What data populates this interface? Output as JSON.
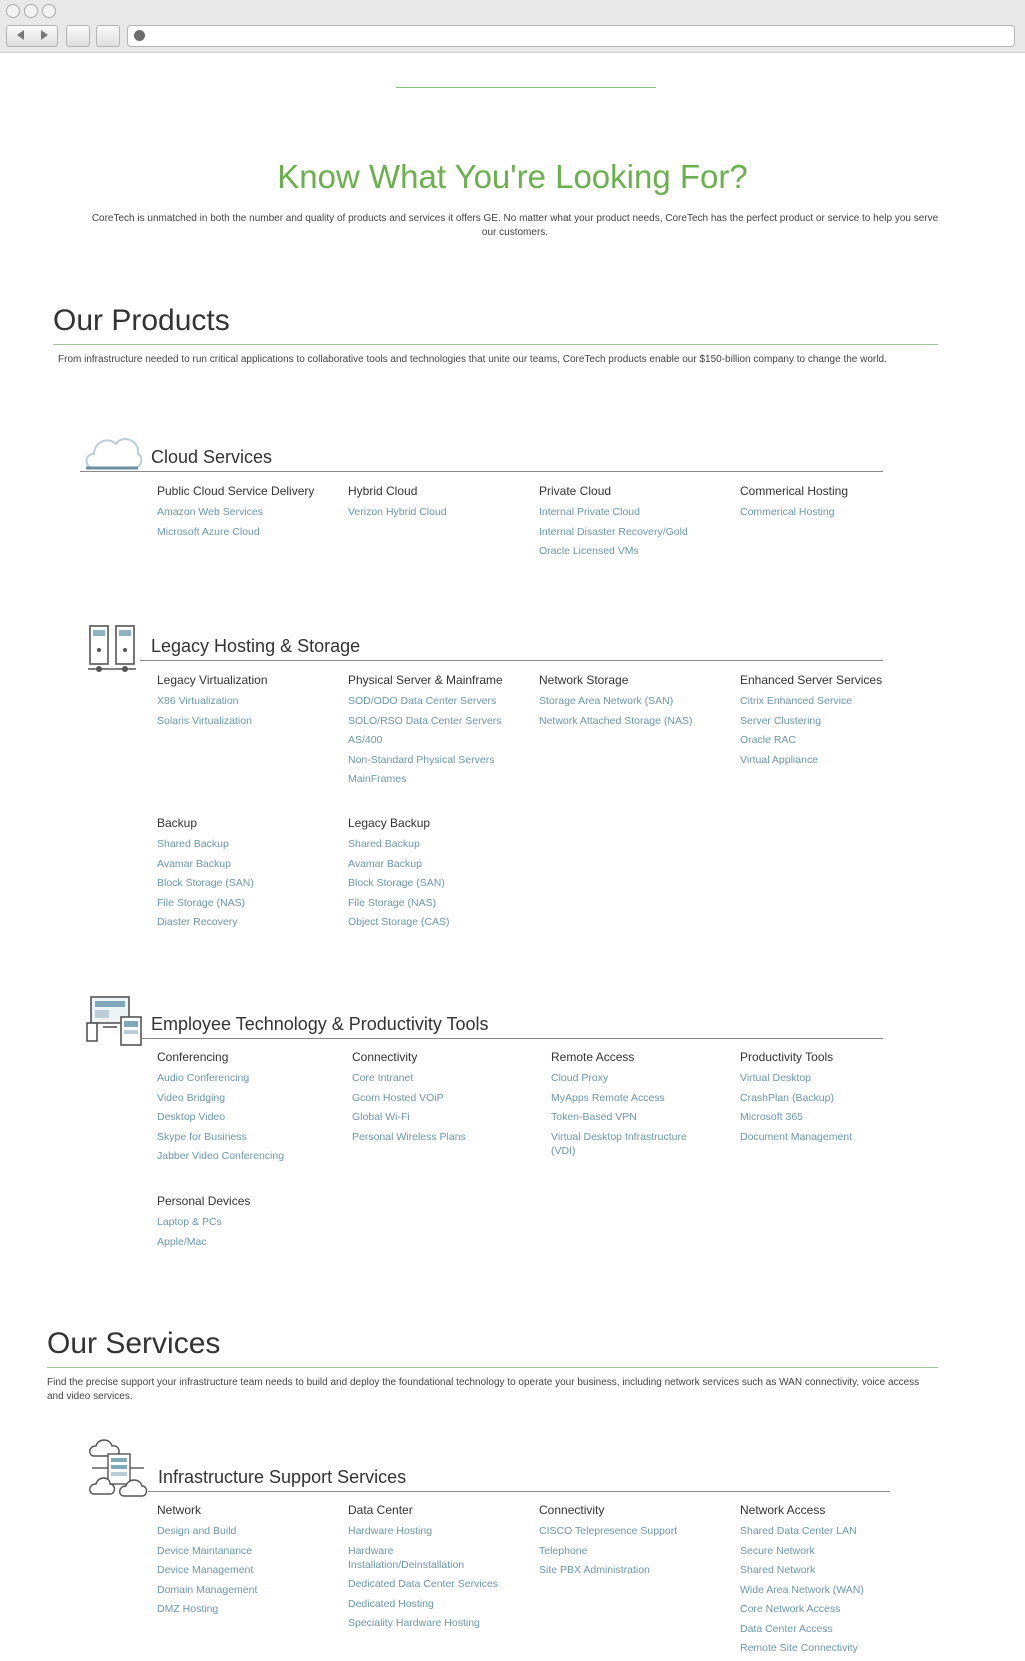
{
  "hero": {
    "title": "Know What You're Looking For?",
    "description": "CoreTech is unmatched in both the number and quality of products and services it offers GE.  No matter what your product needs, CoreTech has the perfect product or service to help you serve our customers."
  },
  "products": {
    "title": "Our Products",
    "description": "From infrastructure needed to run critical applications to collaborative tools and technologies that unite our teams, CoreTech products enable our $150-billion company to change the world.",
    "categories": [
      {
        "title": "Cloud Services",
        "icon": "cloud-icon",
        "columns": [
          {
            "title": "Public Cloud Service Delivery",
            "links": [
              "Amazon Web Services",
              "Microsoft Azure Cloud"
            ]
          },
          {
            "title": "Hybrid Cloud",
            "links": [
              "Verizon Hybrid Cloud"
            ]
          },
          {
            "title": "Private Cloud",
            "links": [
              "Internal Private Cloud",
              "Internal Disaster Recovery/Gold",
              "Oracle Licensed VMs"
            ]
          },
          {
            "title": "Commerical Hosting",
            "links": [
              "Commerical Hosting"
            ]
          }
        ]
      },
      {
        "title": "Legacy Hosting & Storage",
        "icon": "server-icon",
        "columns": [
          {
            "title": "Legacy Virtualization",
            "links": [
              "X86 Virtualization",
              "Solaris Virtualization"
            ]
          },
          {
            "title": "Physical Server & Mainframe",
            "links": [
              "SOD/ODO Data Center Servers",
              "SOLO/RSO Data Center Servers",
              "AS/400",
              "Non-Standard Physical Servers",
              "MainFrames"
            ]
          },
          {
            "title": "Network Storage",
            "links": [
              "Storage Area Network (SAN)",
              "Network Attached Storage (NAS)"
            ]
          },
          {
            "title": "Enhanced Server Services",
            "links": [
              "Citrix Enhanced Service",
              "Server Clustering",
              "Oracle RAC",
              "Virtual Appliance"
            ]
          },
          {
            "title": "Backup",
            "links": [
              "Shared Backup",
              "Avamar Backup",
              "Block Storage (SAN)",
              "File Storage (NAS)",
              "Diaster Recovery"
            ]
          },
          {
            "title": "Legacy Backup",
            "links": [
              "Shared Backup",
              "Avamar Backup",
              "Block Storage (SAN)",
              "File Storage (NAS)",
              "Object Storage (CAS)"
            ]
          }
        ]
      },
      {
        "title": "Employee Technology & Productivity Tools",
        "icon": "devices-icon",
        "columns": [
          {
            "title": "Conferencing",
            "links": [
              "Audio Conferencing",
              "Video Bridging",
              "Desktop Video",
              "Skype for Business",
              "Jabber Video Conferencing"
            ]
          },
          {
            "title": "Connectivity",
            "links": [
              "Core Intranet",
              "Gcom Hosted VOiP",
              "Global Wi-Fi",
              "Personal Wireless Plans"
            ]
          },
          {
            "title": "Remote Access",
            "links": [
              "Cloud Proxy",
              "MyApps Remote Access",
              "Token-Based VPN",
              "Virtual Desktop Infrastructure (VDI)"
            ]
          },
          {
            "title": "Productivity Tools",
            "links": [
              "Virtual Desktop",
              "CrashPlan (Backup)",
              "Microsoft 365",
              "Document Management"
            ]
          },
          {
            "title": "Personal Devices",
            "links": [
              "Laptop & PCs",
              "Apple/Mac"
            ]
          }
        ]
      }
    ]
  },
  "services": {
    "title": "Our Services",
    "description": "Find the precise support your infrastructure team needs to build and deploy the foundational technology to operate your business, including network services such as WAN connectivity, voice access and video services.",
    "categories": [
      {
        "title": "Infrastructure Support Services",
        "icon": "infrastructure-icon",
        "columns": [
          {
            "title": "Network",
            "links": [
              "Design and Build",
              "Device Maintanance",
              "Device Management",
              "Domain Management",
              "DMZ Hosting"
            ]
          },
          {
            "title": "Data Center",
            "links": [
              "Hardware Hosting",
              "Hardware Installation/Deinstallation",
              "Dedicated Data Center Services",
              "Dedicated Hosting",
              "Speciality Hardware Hosting"
            ]
          },
          {
            "title": "Connectivity",
            "links": [
              "CISCO Telepresence Support",
              "Telephone",
              "Site PBX Administration"
            ]
          },
          {
            "title": "Network Access",
            "links": [
              "Shared Data Center LAN",
              "Secure Network",
              "Shared Network",
              "Wide Area Network (WAN)",
              "Core Network Access",
              "Data Center Access",
              "Remote Site Connectivity"
            ]
          }
        ]
      }
    ]
  }
}
